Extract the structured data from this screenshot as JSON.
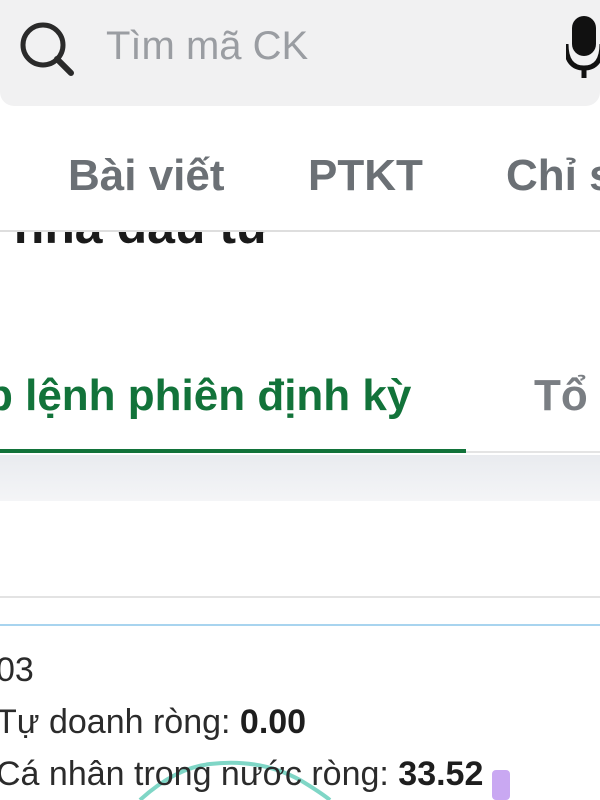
{
  "search": {
    "placeholder": "Tìm mã CK"
  },
  "tabs": [
    {
      "label": "Bài viết"
    },
    {
      "label": "PTKT"
    },
    {
      "label": "Chỉ s"
    }
  ],
  "section_heading": "i nhà đầu tư",
  "subtabs": [
    {
      "label": "p lệnh phiên định kỳ",
      "active": true
    },
    {
      "label": "Tổ",
      "active": false
    }
  ],
  "tooltip": {
    "date": "03",
    "rows": [
      {
        "label": "Tự doanh ròng:",
        "value": "0.00"
      },
      {
        "label": "Cá nhân trong nước ròng:",
        "value": "33.52"
      }
    ]
  },
  "colors": {
    "accent_green": "#12733a",
    "search_bg": "#f1f1f2",
    "chart_line": "#7fd6c6",
    "chart_marker": "#c9a8f2"
  }
}
